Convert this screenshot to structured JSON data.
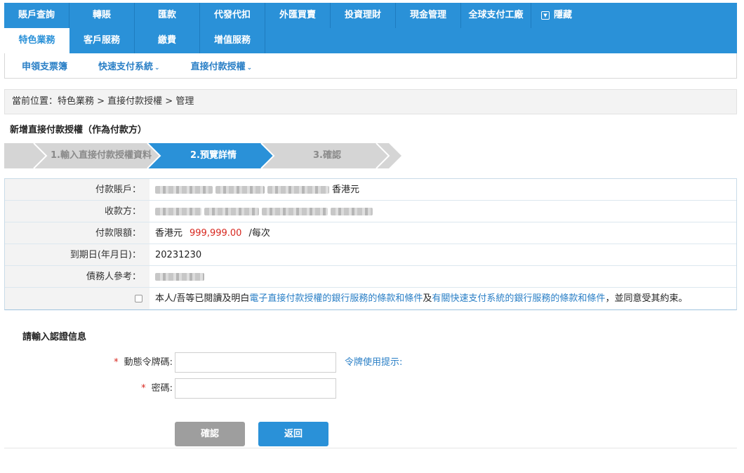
{
  "nav": {
    "row1": [
      "賬戶查詢",
      "轉賬",
      "匯款",
      "代發代扣",
      "外匯買賣",
      "投資理財",
      "現金管理",
      "全球支付工廠"
    ],
    "hide_label": "隱藏",
    "row2": [
      "特色業務",
      "客戶服務",
      "繳費",
      "增值服務"
    ]
  },
  "subnav": [
    "申領支票簿",
    "快速支付系統",
    "直接付款授權"
  ],
  "breadcrumb": "當前位置：特色業務 > 直接付款授權 > 管理",
  "page_title": "新增直接付款授權（作為付款方）",
  "steps": [
    "1.輸入直接付款授權資料",
    "2.預覽詳情",
    "3.確認"
  ],
  "details": {
    "payer_label": "付款賬戶：",
    "payer_currency": "香港元",
    "payee_label": "收款方：",
    "limit_label": "付款限額：",
    "limit_currency": "香港元",
    "limit_amount": "999,999.00",
    "limit_unit": "/每次",
    "expiry_label": "到期日(年月日)：",
    "expiry_value": "20231230",
    "debtor_ref_label": "債務人參考：",
    "terms": {
      "prefix": "本人/吾等已閱讀及明白",
      "link1": "電子直接付款授權的銀行服務的條款和條件",
      "middle": "及",
      "link2": "有關快速支付系統的銀行服務的條款和條件",
      "suffix": "，並同意受其約束。"
    }
  },
  "auth": {
    "title": "請輸入認證信息",
    "token_label": "動態令牌碼:",
    "token_value": "",
    "token_hint": "令牌使用提示:",
    "password_label": "密碼:",
    "password_value": "",
    "required_mark": "*"
  },
  "buttons": {
    "confirm": "確認",
    "back": "返回"
  },
  "colors": {
    "primary": "#2a91d8",
    "link": "#2a7fc6",
    "amount": "#d7271f",
    "disabled_button": "#9e9e9e",
    "step_inactive": "#d5d5d5"
  }
}
